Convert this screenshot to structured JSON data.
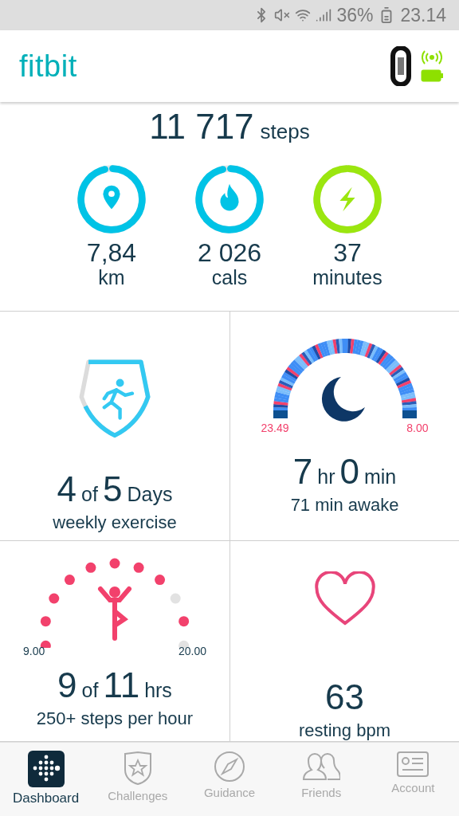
{
  "status_bar": {
    "battery": "36%",
    "time": "23.14"
  },
  "header": {
    "logo": "fitbit"
  },
  "summary": {
    "steps": "11 717",
    "steps_unit": "steps",
    "rings": [
      {
        "kind": "distance",
        "value": "7,84",
        "unit": "km",
        "color": "#00c3e6"
      },
      {
        "kind": "calories",
        "value": "2 026",
        "unit": "cals",
        "color": "#00c3e6"
      },
      {
        "kind": "active",
        "value": "37",
        "unit": "minutes",
        "color": "#9be60f"
      }
    ]
  },
  "tiles": [
    {
      "kind": "exercise",
      "count": "4",
      "of": "of",
      "total": "5",
      "unit": "Days",
      "label": "weekly exercise"
    },
    {
      "kind": "sleep",
      "hours": "7",
      "hours_unit": "hr",
      "minutes": "0",
      "minutes_unit": "min",
      "label": "71 min awake",
      "start": "23.49",
      "end": "8.00"
    },
    {
      "kind": "hourly",
      "count": "9",
      "of": "of",
      "total": "11",
      "unit": "hrs",
      "label": "250+ steps per hour",
      "start": "9.00",
      "end": "20.00",
      "hours": [
        true,
        true,
        true,
        true,
        true,
        true,
        true,
        true,
        false,
        true,
        false
      ]
    },
    {
      "kind": "heart",
      "value": "63",
      "label": "resting bpm"
    }
  ],
  "nav": [
    {
      "label": "Dashboard",
      "selected": true
    },
    {
      "label": "Challenges",
      "selected": false
    },
    {
      "label": "Guidance",
      "selected": false
    },
    {
      "label": "Friends",
      "selected": false
    },
    {
      "label": "Account",
      "selected": false
    }
  ]
}
